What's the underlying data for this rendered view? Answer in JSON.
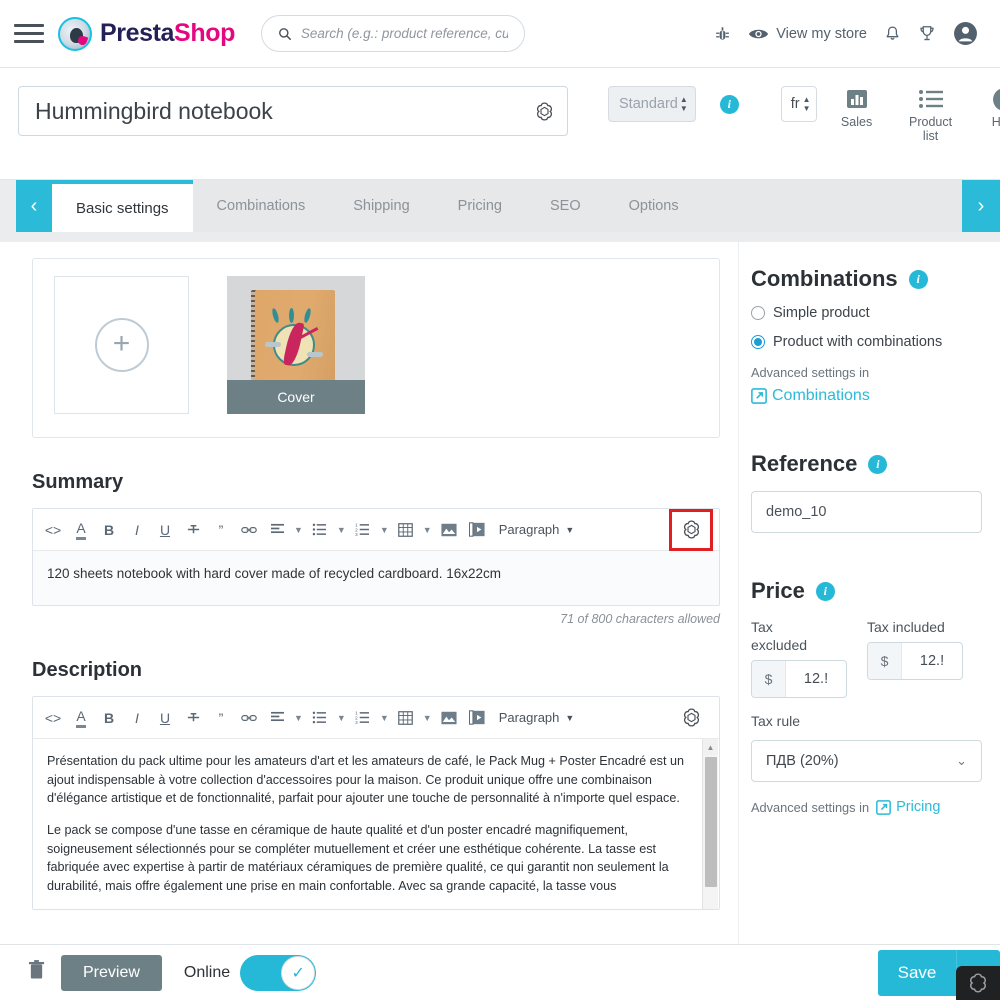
{
  "topnav": {
    "menu_icon": "hamburger-icon",
    "brand": {
      "part1": "Presta",
      "part2": "Shop",
      "logo_icon": "prestashop-logo-icon"
    },
    "search": {
      "placeholder": "Search (e.g.: product reference, custom",
      "icon": "search-icon"
    },
    "debug_icon": "bug-icon",
    "view_store": {
      "label": "View my store",
      "icon": "eye-icon"
    },
    "notifications_icon": "bell-icon",
    "trophy_icon": "trophy-icon",
    "account_icon": "user-account-icon"
  },
  "header": {
    "product_name": "Hummingbird notebook",
    "assistant_icon": "openai-assistant-icon",
    "product_type": "Standard",
    "type_info_icon": "info-icon",
    "language": "fr",
    "tools": [
      {
        "label": "Sales",
        "icon": "bar-chart-icon"
      },
      {
        "label": "Product list",
        "icon": "list-icon"
      },
      {
        "label": "Help",
        "icon": "question-mark-icon"
      }
    ]
  },
  "tabs": {
    "prev_label": "‹",
    "next_label": "›",
    "items": [
      {
        "label": "Basic settings",
        "active": true
      },
      {
        "label": "Combinations",
        "active": false
      },
      {
        "label": "Shipping",
        "active": false
      },
      {
        "label": "Pricing",
        "active": false
      },
      {
        "label": "SEO",
        "active": false
      },
      {
        "label": "Options",
        "active": false
      }
    ]
  },
  "images": {
    "add_label": "+",
    "cover_caption": "Cover"
  },
  "summary": {
    "title": "Summary",
    "content": "120 sheets notebook with hard cover made of recycled cardboard. 16x22cm",
    "charcount": "71 of 800 characters allowed",
    "paragraph_label": "Paragraph"
  },
  "description": {
    "title": "Description",
    "paragraph_label": "Paragraph",
    "p1": "Présentation du pack ultime pour les amateurs d'art et les amateurs de café, le Pack Mug + Poster Encadré est un ajout indispensable à votre collection d'accessoires pour la maison. Ce produit unique offre une combinaison d'élégance artistique et de fonctionnalité, parfait pour ajouter une touche de personnalité à n'importe quel espace.",
    "p2": "Le pack se compose d'une tasse en céramique de haute qualité et d'un poster encadré magnifiquement, soigneusement sélectionnés pour se compléter mutuellement et créer une esthétique cohérente. La tasse est fabriquée avec expertise à partir de matériaux céramiques de première qualité, ce qui garantit non seulement la durabilité, mais offre également une prise en main confortable. Avec sa grande capacité, la tasse vous"
  },
  "combinations": {
    "title": "Combinations",
    "info_icon": "info-icon",
    "option_simple": "Simple product",
    "option_combinations": "Product with combinations",
    "selected": "Product with combinations",
    "advanced_text": "Advanced settings in",
    "advanced_link": "Combinations",
    "external_icon": "external-link-icon"
  },
  "reference": {
    "title": "Reference",
    "info_icon": "info-icon",
    "value": "demo_10"
  },
  "price": {
    "title": "Price",
    "info_icon": "info-icon",
    "tax_excluded_label": "Tax excluded",
    "tax_excluded_currency": "$",
    "tax_excluded_value": "12.!",
    "tax_included_label": "Tax included",
    "tax_included_currency": "$",
    "tax_included_value": "12.!",
    "tax_rule_label": "Tax rule",
    "tax_rule_value": "ПДВ (20%)",
    "advanced_text": "Advanced settings in",
    "advanced_link": "Pricing",
    "external_icon": "external-link-icon"
  },
  "footer": {
    "delete_icon": "trash-icon",
    "preview_label": "Preview",
    "online_label": "Online",
    "online_state": "on",
    "save_label": "Save",
    "save_caret": "⌄"
  }
}
